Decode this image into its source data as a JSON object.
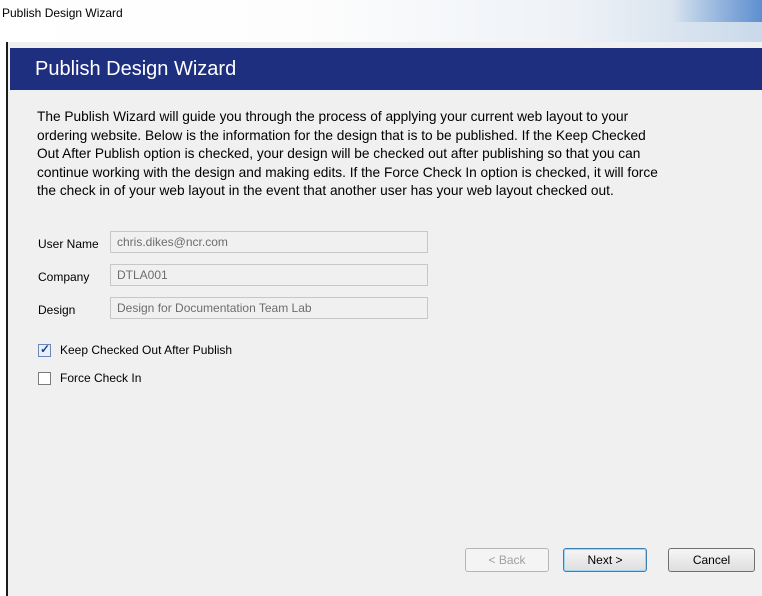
{
  "window": {
    "title": "Publish Design Wizard"
  },
  "banner": {
    "title": "Publish Design Wizard"
  },
  "intro": {
    "lines": [
      "The Publish Wizard will guide you through the process of applying your current web layout to your",
      "ordering website. Below is the information for the design that is to be published. If the Keep Checked",
      "Out After Publish option is checked, your design will be checked out after publishing so that you can",
      "continue working with the design and making edits. If the Force Check In option is checked, it will force",
      "the check in of your web layout in the event that another user has your web layout checked out."
    ]
  },
  "form": {
    "user_name": {
      "label": "User Name",
      "value": "chris.dikes@ncr.com"
    },
    "company": {
      "label": "Company",
      "value": "DTLA001"
    },
    "design": {
      "label": "Design",
      "value": "Design for Documentation Team Lab"
    }
  },
  "options": {
    "keep_checked_out": {
      "label": "Keep Checked Out After Publish",
      "checked": true
    },
    "force_check_in": {
      "label": "Force Check In",
      "checked": false
    }
  },
  "buttons": {
    "back": "< Back",
    "next": "Next >",
    "cancel": "Cancel"
  },
  "colors": {
    "banner": "#1f2f80",
    "disabled_text": "#a0a0a0"
  }
}
